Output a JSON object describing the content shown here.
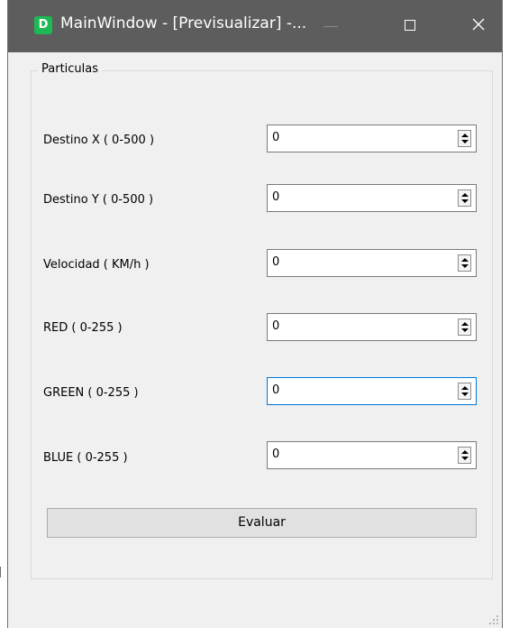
{
  "window": {
    "app_icon_letter": "D",
    "title": "MainWindow - [Previsualizar] -..."
  },
  "group": {
    "title": "Particulas"
  },
  "fields": [
    {
      "label": "Destino X  ( 0-500 )",
      "value": "0"
    },
    {
      "label": "Destino Y  ( 0-500 )",
      "value": "0"
    },
    {
      "label": "Velocidad ( KM/h )",
      "value": "0"
    },
    {
      "label": "RED ( 0-255 )",
      "value": "0"
    },
    {
      "label": "GREEN ( 0-255 )",
      "value": "0"
    },
    {
      "label": "BLUE ( 0-255 )",
      "value": "0"
    }
  ],
  "buttons": {
    "evaluate_label": "Evaluar"
  },
  "colors": {
    "titlebar": "#5d5d5d",
    "window_bg": "#f0f0f0",
    "focus_border": "#0078d7",
    "app_icon": "#1db954"
  },
  "icons": {
    "app": "app-icon",
    "minimize": "minimize-icon",
    "maximize": "maximize-icon",
    "close": "close-icon",
    "spin_up": "spin-up-arrow-icon",
    "spin_down": "spin-down-arrow-icon",
    "grip": "resize-grip-icon"
  }
}
